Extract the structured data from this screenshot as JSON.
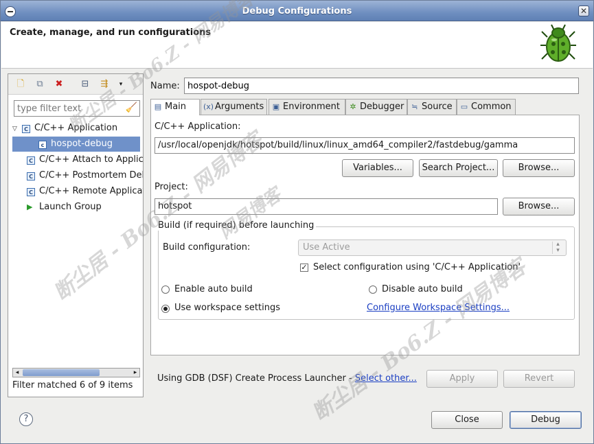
{
  "window": {
    "title": "Debug Configurations"
  },
  "banner": {
    "headline": "Create, manage, and run configurations"
  },
  "left_panel": {
    "filter_placeholder": "type filter text",
    "tree": [
      {
        "label": "C/C++ Application",
        "type": "category",
        "expanded": true
      },
      {
        "label": "hospot-debug",
        "type": "config",
        "selected": true
      },
      {
        "label": "C/C++ Attach to Application",
        "type": "category"
      },
      {
        "label": "C/C++ Postmortem Debugger",
        "type": "category"
      },
      {
        "label": "C/C++ Remote Application",
        "type": "category"
      },
      {
        "label": "Launch Group",
        "type": "launch-group"
      }
    ],
    "status": "Filter matched 6 of 9 items"
  },
  "config": {
    "name_label": "Name:",
    "name_value": "hospot-debug",
    "tabs": [
      {
        "label": "Main",
        "icon": "main-tab-icon",
        "active": true
      },
      {
        "label": "Arguments",
        "icon": "arguments-tab-icon"
      },
      {
        "label": "Environment",
        "icon": "environment-tab-icon"
      },
      {
        "label": "Debugger",
        "icon": "debugger-tab-icon"
      },
      {
        "label": "Source",
        "icon": "source-tab-icon"
      },
      {
        "label": "Common",
        "icon": "common-tab-icon"
      }
    ]
  },
  "main_tab": {
    "app_label": "C/C++ Application:",
    "app_path": "/usr/local/openjdk/hotspot/build/linux/linux_amd64_compiler2/fastdebug/gamma",
    "variables_button": "Variables...",
    "search_project_button": "Search Project...",
    "browse_button": "Browse...",
    "project_label": "Project:",
    "project_value": "hotspot",
    "project_browse_button": "Browse...",
    "build_group_title": "Build (if required) before launching",
    "build_config_label": "Build configuration:",
    "build_config_value": "Use Active",
    "select_config_checkbox": "Select configuration using 'C/C++ Application'",
    "enable_auto_build": "Enable auto build",
    "disable_auto_build": "Disable auto build",
    "use_workspace_settings": "Use workspace settings",
    "configure_workspace_link": "Configure Workspace Settings..."
  },
  "launcher": {
    "text": "Using GDB (DSF) Create Process Launcher - ",
    "link": "Select other..."
  },
  "actions": {
    "apply": "Apply",
    "revert": "Revert",
    "close": "Close",
    "debug": "Debug",
    "help": "?"
  },
  "watermarks": [
    "断尘居 - Bo6.Z - 网易博客",
    "断尘居 - Bo6.Z - 网易博客",
    "断尘居 - Bo6.Z - 网易博客",
    "网易博客"
  ]
}
